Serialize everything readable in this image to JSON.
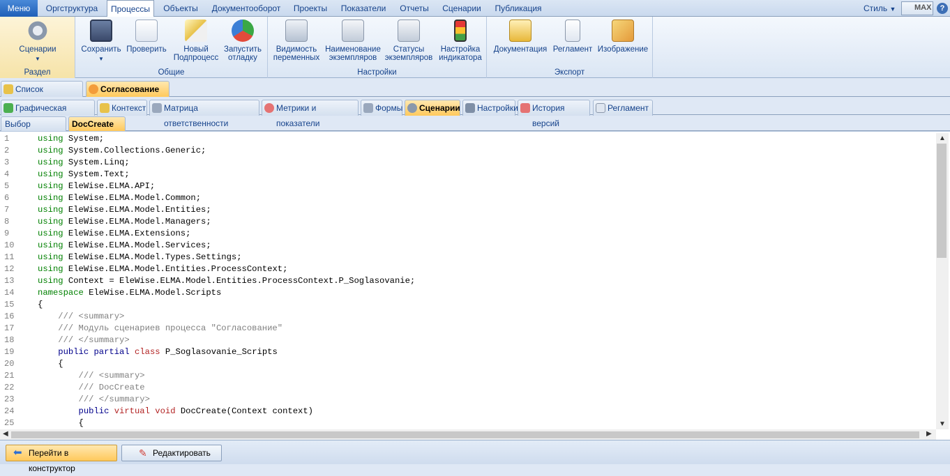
{
  "menubar": {
    "menu_label": "Меню",
    "tabs": [
      "Оргструктура",
      "Процессы",
      "Объекты",
      "Документооборот",
      "Проекты",
      "Показатели",
      "Отчеты",
      "Сценарии",
      "Публикация"
    ],
    "active_tab": "Процессы",
    "style_label": "Стиль",
    "max_label": "MAX",
    "help_label": "?"
  },
  "ribbon": {
    "groups": {
      "razdel": {
        "label": "Раздел",
        "buttons": [
          "Сценарии"
        ]
      },
      "obshie": {
        "label": "Общие",
        "buttons": [
          "Сохранить",
          "Проверить",
          "Новый Подпроцесс",
          "Запустить отладку"
        ]
      },
      "nastroiki": {
        "label": "Настройки",
        "buttons": [
          "Видимость переменных",
          "Наименование экземпляров",
          "Статусы экземпляров",
          "Настройка индикатора"
        ]
      },
      "eksport": {
        "label": "Экспорт",
        "buttons": [
          "Документация",
          "Регламент",
          "Изображение"
        ]
      }
    },
    "btn": {
      "scenarii_1": "Сценарии",
      "save_1": "Сохранить",
      "check_1": "Проверить",
      "new_1": "Новый",
      "new_2": "Подпроцесс",
      "run_1": "Запустить",
      "run_2": "отладку",
      "vis_1": "Видимость",
      "vis_2": "переменных",
      "name_1": "Наименование",
      "name_2": "экземпляров",
      "stat_1": "Статусы",
      "stat_2": "экземпляров",
      "ind_1": "Настройка",
      "ind_2": "индикатора",
      "doc_1": "Документация",
      "reg_1": "Регламент",
      "img_1": "Изображение"
    }
  },
  "doc_tabs": [
    {
      "label": "Список процессов",
      "active": false
    },
    {
      "label": "Согласование",
      "active": true
    }
  ],
  "sub_tabs": [
    {
      "label": "Графическая модель"
    },
    {
      "label": "Контекст"
    },
    {
      "label": "Матрица ответственности"
    },
    {
      "label": "Метрики и показатели"
    },
    {
      "label": "Формы"
    },
    {
      "label": "Сценарии"
    },
    {
      "label": "Настройки"
    },
    {
      "label": "История версий"
    },
    {
      "label": "Регламент"
    }
  ],
  "scenario_tabs": [
    {
      "label": "Выбор сценария"
    },
    {
      "label": "DocCreate"
    }
  ],
  "code_lines": [
    [
      [
        "u",
        "using"
      ],
      [
        "t",
        " System;"
      ]
    ],
    [
      [
        "u",
        "using"
      ],
      [
        "t",
        " System.Collections.Generic;"
      ]
    ],
    [
      [
        "u",
        "using"
      ],
      [
        "t",
        " System.Linq;"
      ]
    ],
    [
      [
        "u",
        "using"
      ],
      [
        "t",
        " System.Text;"
      ]
    ],
    [
      [
        "u",
        "using"
      ],
      [
        "t",
        " EleWise.ELMA.API;"
      ]
    ],
    [
      [
        "u",
        "using"
      ],
      [
        "t",
        " EleWise.ELMA.Model.Common;"
      ]
    ],
    [
      [
        "u",
        "using"
      ],
      [
        "t",
        " EleWise.ELMA.Model.Entities;"
      ]
    ],
    [
      [
        "u",
        "using"
      ],
      [
        "t",
        " EleWise.ELMA.Model.Managers;"
      ]
    ],
    [
      [
        "u",
        "using"
      ],
      [
        "t",
        " EleWise.ELMA.Extensions;"
      ]
    ],
    [
      [
        "u",
        "using"
      ],
      [
        "t",
        " EleWise.ELMA.Model.Services;"
      ]
    ],
    [
      [
        "u",
        "using"
      ],
      [
        "t",
        " EleWise.ELMA.Model.Types.Settings;"
      ]
    ],
    [
      [
        "u",
        "using"
      ],
      [
        "t",
        " EleWise.ELMA.Model.Entities.ProcessContext;"
      ]
    ],
    [
      [
        "u",
        "using"
      ],
      [
        "t",
        " Context = EleWise.ELMA.Model.Entities.ProcessContext.P_Soglasovanie;"
      ]
    ],
    [
      [
        "u",
        "namespace"
      ],
      [
        "t",
        " EleWise.ELMA.Model.Scripts"
      ]
    ],
    [
      [
        "t",
        "{"
      ]
    ],
    [
      [
        "c",
        "    /// <summary>"
      ]
    ],
    [
      [
        "c",
        "    /// Модуль сценариев процесса \"Согласование\""
      ]
    ],
    [
      [
        "c",
        "    /// </summary>"
      ]
    ],
    [
      [
        "t",
        "    "
      ],
      [
        "b",
        "public"
      ],
      [
        "t",
        " "
      ],
      [
        "b",
        "partial"
      ],
      [
        "t",
        " "
      ],
      [
        "r",
        "class"
      ],
      [
        "t",
        " P_Soglasovanie_Scripts"
      ]
    ],
    [
      [
        "t",
        "    {"
      ]
    ],
    [
      [
        "c",
        "        /// <summary>"
      ]
    ],
    [
      [
        "c",
        "        /// DocCreate"
      ]
    ],
    [
      [
        "c",
        "        /// </summary>"
      ]
    ],
    [
      [
        "t",
        "        "
      ],
      [
        "b",
        "public"
      ],
      [
        "t",
        " "
      ],
      [
        "r",
        "virtual"
      ],
      [
        "t",
        " "
      ],
      [
        "r",
        "void"
      ],
      [
        "t",
        " DocCreate(Context context)"
      ]
    ],
    [
      [
        "t",
        "        {"
      ]
    ]
  ],
  "bottom": {
    "goto_label": "Перейти в конструктор",
    "edit_label": "Редактировать"
  },
  "colors": {
    "keyword_using": "#008000",
    "keyword_public": "#00008b",
    "keyword_class": "#b22222",
    "comment": "#808080",
    "active_tab": "#ffc95c"
  }
}
